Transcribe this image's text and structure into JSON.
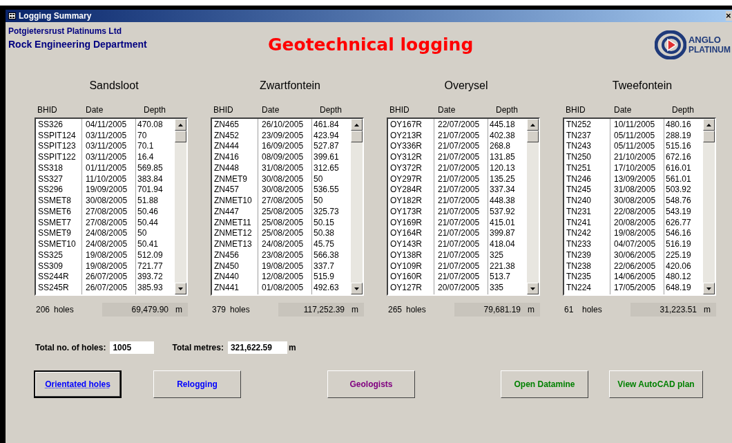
{
  "window": {
    "title": "Logging Summary",
    "close": "×"
  },
  "header": {
    "company": "Potgietersrust Platinums Ltd",
    "department": "Rock Engineering Department",
    "title": "Geotechnical logging",
    "logo_line_1": "ANGLO",
    "logo_line_2": "PLATINUM"
  },
  "sites": [
    {
      "name": "Sandsloot",
      "columns": [
        "BHID",
        "Date",
        "Depth"
      ],
      "holes_count": "206",
      "holes_label": "holes",
      "metres": "69,479.90",
      "unit": "m",
      "rows": [
        [
          "SS326",
          "04/11/2005",
          "470.08"
        ],
        [
          "SSPIT124",
          "03/11/2005",
          "70"
        ],
        [
          "SSPIT123",
          "03/11/2005",
          "70.1"
        ],
        [
          "SSPIT122",
          "03/11/2005",
          "16.4"
        ],
        [
          "SS318",
          "01/11/2005",
          "569.85"
        ],
        [
          "SS327",
          "11/10/2005",
          "383.84"
        ],
        [
          "SS296",
          "19/09/2005",
          "701.94"
        ],
        [
          "SSMET8",
          "30/08/2005",
          "51.88"
        ],
        [
          "SSMET6",
          "27/08/2005",
          "50.46"
        ],
        [
          "SSMET7",
          "27/08/2005",
          "50.44"
        ],
        [
          "SSMET9",
          "24/08/2005",
          "50"
        ],
        [
          "SSMET10",
          "24/08/2005",
          "50.41"
        ],
        [
          "SS325",
          "19/08/2005",
          "512.09"
        ],
        [
          "SS309",
          "19/08/2005",
          "721.77"
        ],
        [
          "SS244R",
          "26/07/2005",
          "393.72"
        ],
        [
          "SS245R",
          "26/07/2005",
          "385.93"
        ]
      ]
    },
    {
      "name": "Zwartfontein",
      "columns": [
        "BHID",
        "Date",
        "Depth"
      ],
      "holes_count": "379",
      "holes_label": "holes",
      "metres": "117,252.39",
      "unit": "m",
      "rows": [
        [
          "ZN465",
          "26/10/2005",
          "461.84"
        ],
        [
          "ZN452",
          "23/09/2005",
          "423.94"
        ],
        [
          "ZN444",
          "16/09/2005",
          "527.87"
        ],
        [
          "ZN416",
          "08/09/2005",
          "399.61"
        ],
        [
          "ZN448",
          "31/08/2005",
          "312.65"
        ],
        [
          "ZNMET9",
          "30/08/2005",
          "50"
        ],
        [
          "ZN457",
          "30/08/2005",
          "536.55"
        ],
        [
          "ZNMET10",
          "27/08/2005",
          "50"
        ],
        [
          "ZN447",
          "25/08/2005",
          "325.73"
        ],
        [
          "ZNMET11",
          "25/08/2005",
          "50.15"
        ],
        [
          "ZNMET12",
          "25/08/2005",
          "50.38"
        ],
        [
          "ZNMET13",
          "24/08/2005",
          "45.75"
        ],
        [
          "ZN456",
          "23/08/2005",
          "566.38"
        ],
        [
          "ZN450",
          "19/08/2005",
          "337.7"
        ],
        [
          "ZN440",
          "12/08/2005",
          "515.9"
        ],
        [
          "ZN441",
          "01/08/2005",
          "492.63"
        ]
      ]
    },
    {
      "name": "Overysel",
      "columns": [
        "BHID",
        "Date",
        "Depth"
      ],
      "holes_count": "265",
      "holes_label": "holes",
      "metres": "79,681.19",
      "unit": "m",
      "rows": [
        [
          "OY167R",
          "22/07/2005",
          "445.18"
        ],
        [
          "OY213R",
          "21/07/2005",
          "402.38"
        ],
        [
          "OY336R",
          "21/07/2005",
          "268.8"
        ],
        [
          "OY312R",
          "21/07/2005",
          "131.85"
        ],
        [
          "OY372R",
          "21/07/2005",
          "120.13"
        ],
        [
          "OY297R",
          "21/07/2005",
          "135.25"
        ],
        [
          "OY284R",
          "21/07/2005",
          "337.34"
        ],
        [
          "OY182R",
          "21/07/2005",
          "448.38"
        ],
        [
          "OY173R",
          "21/07/2005",
          "537.92"
        ],
        [
          "OY169R",
          "21/07/2005",
          "415.01"
        ],
        [
          "OY164R",
          "21/07/2005",
          "399.87"
        ],
        [
          "OY143R",
          "21/07/2005",
          "418.04"
        ],
        [
          "OY138R",
          "21/07/2005",
          "325"
        ],
        [
          "OY109R",
          "21/07/2005",
          "221.38"
        ],
        [
          "OY160R",
          "21/07/2005",
          "513.7"
        ],
        [
          "OY127R",
          "20/07/2005",
          "335"
        ]
      ]
    },
    {
      "name": "Tweefontein",
      "columns": [
        "BHID",
        "Date",
        "Depth"
      ],
      "holes_count": "61",
      "holes_label": "holes",
      "metres": "31,223.51",
      "unit": "m",
      "rows": [
        [
          "TN252",
          "10/11/2005",
          "480.16"
        ],
        [
          "TN237",
          "05/11/2005",
          "288.19"
        ],
        [
          "TN243",
          "05/11/2005",
          "515.16"
        ],
        [
          "TN250",
          "21/10/2005",
          "672.16"
        ],
        [
          "TN251",
          "17/10/2005",
          "616.01"
        ],
        [
          "TN246",
          "13/09/2005",
          "561.01"
        ],
        [
          "TN245",
          "31/08/2005",
          "503.92"
        ],
        [
          "TN240",
          "30/08/2005",
          "548.76"
        ],
        [
          "TN231",
          "22/08/2005",
          "543.19"
        ],
        [
          "TN241",
          "20/08/2005",
          "626.77"
        ],
        [
          "TN242",
          "19/08/2005",
          "546.16"
        ],
        [
          "TN233",
          "04/07/2005",
          "516.19"
        ],
        [
          "TN239",
          "30/06/2005",
          "225.19"
        ],
        [
          "TN238",
          "22/06/2005",
          "420.06"
        ],
        [
          "TN235",
          "14/06/2005",
          "480.12"
        ],
        [
          "TN224",
          "17/05/2005",
          "648.19"
        ]
      ]
    }
  ],
  "totals": {
    "holes_label": "Total no. of holes:",
    "holes_value": "1005",
    "metres_label": "Total metres:",
    "metres_value": "321,622.59",
    "unit": "m"
  },
  "buttons": [
    {
      "label": "Orientated holes",
      "color": "#0000ff",
      "focused": true
    },
    {
      "label": "Relogging",
      "color": "#0000ff",
      "focused": false
    },
    {
      "label": "Geologists",
      "color": "#800080",
      "focused": false
    },
    {
      "label": "Open Datamine",
      "color": "#008000",
      "focused": false
    },
    {
      "label": "View AutoCAD plan",
      "color": "#008000",
      "focused": false
    }
  ]
}
